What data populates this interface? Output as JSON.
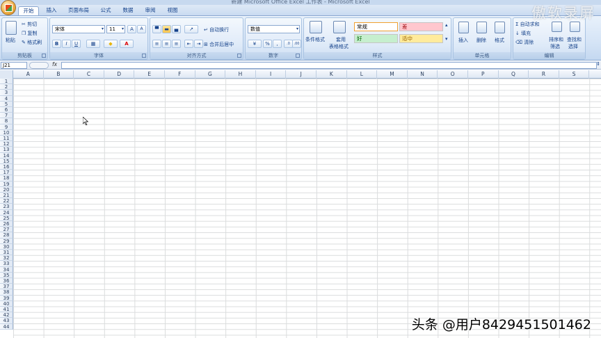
{
  "window": {
    "title": "新建 Microsoft Office Excel 工作表 - Microsoft Excel"
  },
  "tabs": [
    {
      "label": "开始",
      "active": true
    },
    {
      "label": "插入"
    },
    {
      "label": "页面布局"
    },
    {
      "label": "公式"
    },
    {
      "label": "数据"
    },
    {
      "label": "审阅"
    },
    {
      "label": "视图"
    }
  ],
  "clipboard": {
    "paste": "粘贴",
    "cut": "剪切",
    "copy": "复制",
    "format_painter": "格式刷",
    "group": "剪贴板"
  },
  "font": {
    "name": "宋体",
    "size": "11",
    "bold": "B",
    "italic": "I",
    "underline": "U",
    "grow": "A",
    "shrink": "A",
    "color_letter": "A",
    "group": "字体"
  },
  "alignment": {
    "wrap": "自动换行",
    "merge": "合并后居中",
    "group": "对齐方式"
  },
  "number": {
    "format": "数值",
    "percent": "%",
    "comma": ",",
    "group": "数字"
  },
  "styles": {
    "conditional": "条件格式",
    "table_format_1": "套用",
    "table_format_2": "表格格式",
    "normal": "常规",
    "bad": "差",
    "good": "好",
    "neutral": "适中",
    "group": "样式"
  },
  "cells": {
    "insert": "插入",
    "delete": "删除",
    "format": "格式",
    "group": "单元格"
  },
  "editing": {
    "autosum": "自动求和",
    "fill": "填充",
    "clear": "清除",
    "sort_1": "排序和",
    "sort_2": "筛选",
    "find_1": "查找和",
    "find_2": "选择",
    "group": "编辑"
  },
  "formula_bar": {
    "name_box": "J21",
    "fx": "fx"
  },
  "columns": [
    "A",
    "B",
    "C",
    "D",
    "E",
    "F",
    "G",
    "H",
    "I",
    "J",
    "K",
    "L",
    "M",
    "N",
    "O",
    "P",
    "Q",
    "R",
    "S"
  ],
  "rows": [
    "1",
    "2",
    "3",
    "4",
    "5",
    "6",
    "7",
    "8",
    "9",
    "10",
    "11",
    "12",
    "13",
    "14",
    "15",
    "16",
    "17",
    "18",
    "19",
    "20",
    "21",
    "22",
    "23",
    "24",
    "25",
    "26",
    "27",
    "28",
    "29",
    "30",
    "31",
    "32",
    "33",
    "34",
    "35",
    "36",
    "37",
    "38",
    "39",
    "40",
    "41",
    "42",
    "43",
    "44"
  ],
  "watermarks": {
    "top": "傲软录屏",
    "bottom": "头条 @用户8429451501462"
  },
  "colors": {
    "bad_bg": "#ffc7ce",
    "good_bg": "#c6efce",
    "neutral_bg": "#ffeb9c",
    "bad_text": "#9c0006",
    "good_text": "#006100",
    "neutral_text": "#9c6500"
  }
}
